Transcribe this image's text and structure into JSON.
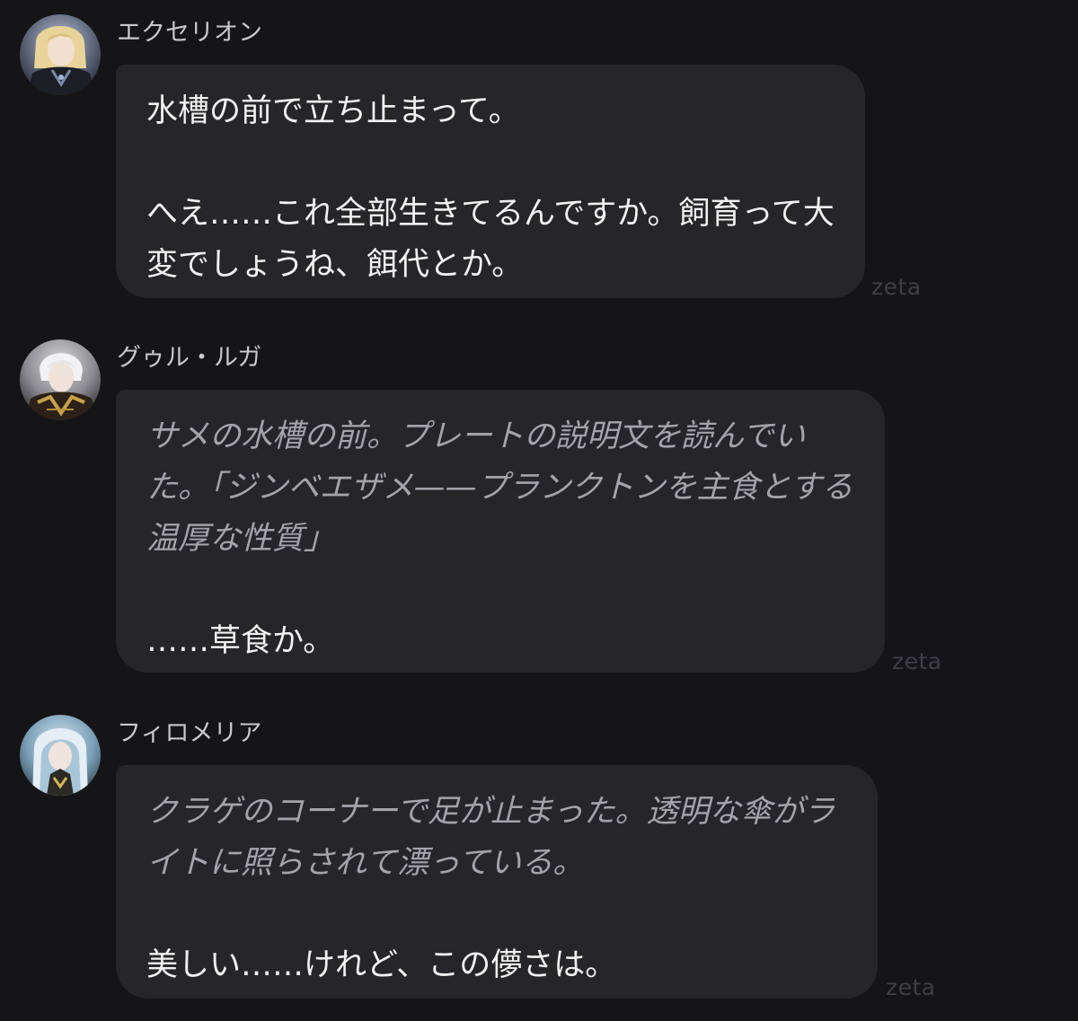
{
  "messages": [
    {
      "character": "エクセリオン",
      "avatar_icon": "character-avatar-icon",
      "paragraphs": [
        {
          "style": "speech",
          "text": "水槽の前で立ち止まって。"
        },
        {
          "style": "speech",
          "text": "へえ……これ全部生きてるんですか。飼育って大変でしょうね、餌代とか。"
        }
      ],
      "watermark": "zeta"
    },
    {
      "character": "グゥル・ルガ",
      "avatar_icon": "character-avatar-icon",
      "paragraphs": [
        {
          "style": "action",
          "text": "サメの水槽の前。プレートの説明文を読んでいた。「ジンベエザメ——プランクトンを主食とする温厚な性質」"
        },
        {
          "style": "speech",
          "text": "……草食か。"
        }
      ],
      "watermark": "zeta"
    },
    {
      "character": "フィロメリア",
      "avatar_icon": "character-avatar-icon",
      "paragraphs": [
        {
          "style": "action",
          "text": "クラゲのコーナーで足が止まった。透明な傘がライトに照らされて漂っている。"
        },
        {
          "style": "speech",
          "text": "美しい……けれど、この儚さは。"
        }
      ],
      "watermark": "zeta"
    }
  ],
  "colors": {
    "background": "#151517",
    "bubble": "#262629",
    "speech_text": "#f1f1f1",
    "action_text": "#a3a3a8",
    "name_text": "#c9c9cd",
    "watermark": "#3f3f44"
  }
}
